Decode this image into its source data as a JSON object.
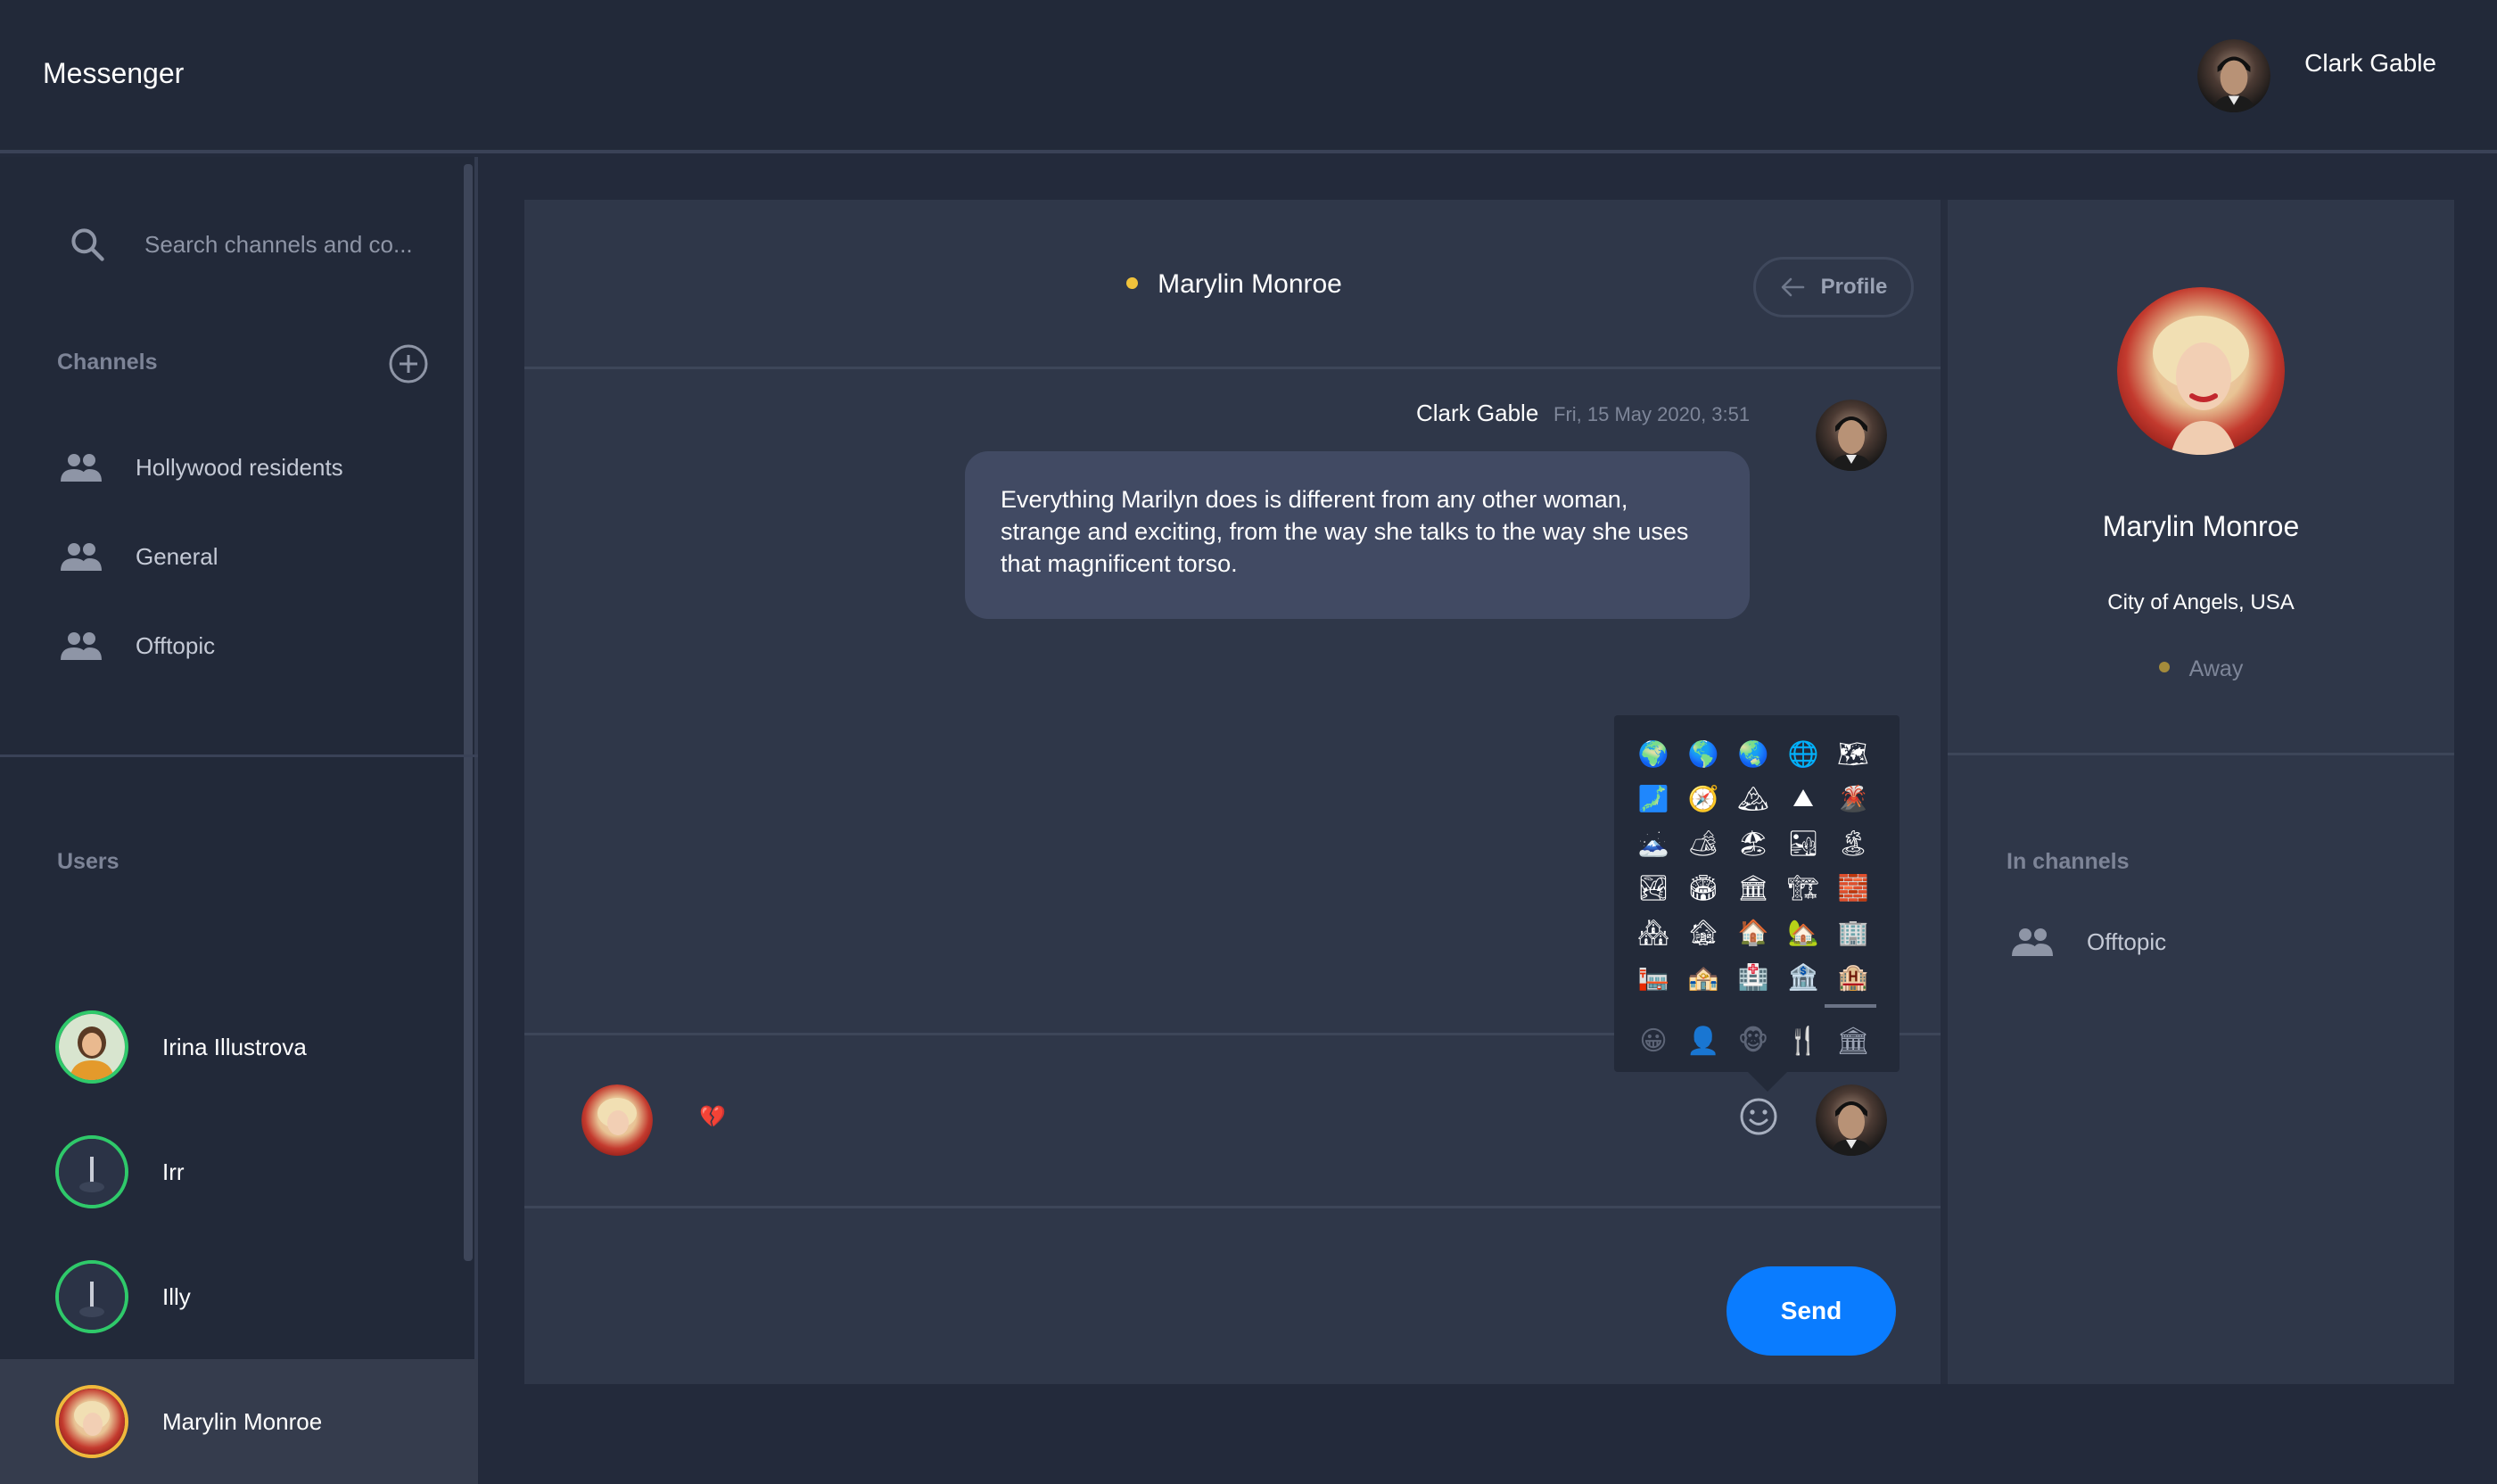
{
  "app": {
    "title": "Messenger"
  },
  "header": {
    "user_name": "Clark Gable"
  },
  "sidebar": {
    "search_placeholder": "Search channels and co...",
    "channels_label": "Channels",
    "channels": [
      {
        "label": "Hollywood residents"
      },
      {
        "label": "General"
      },
      {
        "label": "Offtopic"
      }
    ],
    "users_label": "Users",
    "users": [
      {
        "name": "Irina Illustrova",
        "status": "online"
      },
      {
        "name": "Irr",
        "status": "online"
      },
      {
        "name": "Illy",
        "status": "online"
      },
      {
        "name": "Marylin Monroe",
        "status": "away",
        "selected": true
      }
    ]
  },
  "chat": {
    "contact_name": "Marylin Monroe",
    "profile_button": "Profile",
    "messages": [
      {
        "author": "Clark Gable",
        "time": "Fri, 15 May 2020, 3:51",
        "text": "Everything Marilyn does is different from any other woman, strange and exciting, from the way she talks to the way she uses that magnificent torso."
      }
    ],
    "reply_reaction": "💔",
    "send_label": "Send"
  },
  "emoji_picker": {
    "emojis": [
      "🌍",
      "🌎",
      "🌏",
      "🌐",
      "🗺",
      "🗾",
      "🧭",
      "🏔",
      "⛰",
      "🌋",
      "🗻",
      "🏕",
      "🏖",
      "🏜",
      "🏝",
      "🏞",
      "🏟",
      "🏛",
      "🏗",
      "🧱",
      "🏘",
      "🏚",
      "🏠",
      "🏡",
      "🏢",
      "🏣",
      "🏤",
      "🏥",
      "🏦",
      "🏨"
    ],
    "category_tabs": [
      "😀",
      "👤",
      "🐵",
      "🍴",
      "🏛"
    ],
    "active_tab": 4
  },
  "profile": {
    "name": "Marylin Monroe",
    "location": "City of Angels, USA",
    "status": "Away",
    "in_channels_label": "In channels",
    "channels": [
      {
        "label": "Offtopic"
      }
    ]
  },
  "colors": {
    "accent": "#0a7cff",
    "online": "#2fc96a",
    "away": "#f0b93b",
    "reaction": "#e0334a"
  }
}
